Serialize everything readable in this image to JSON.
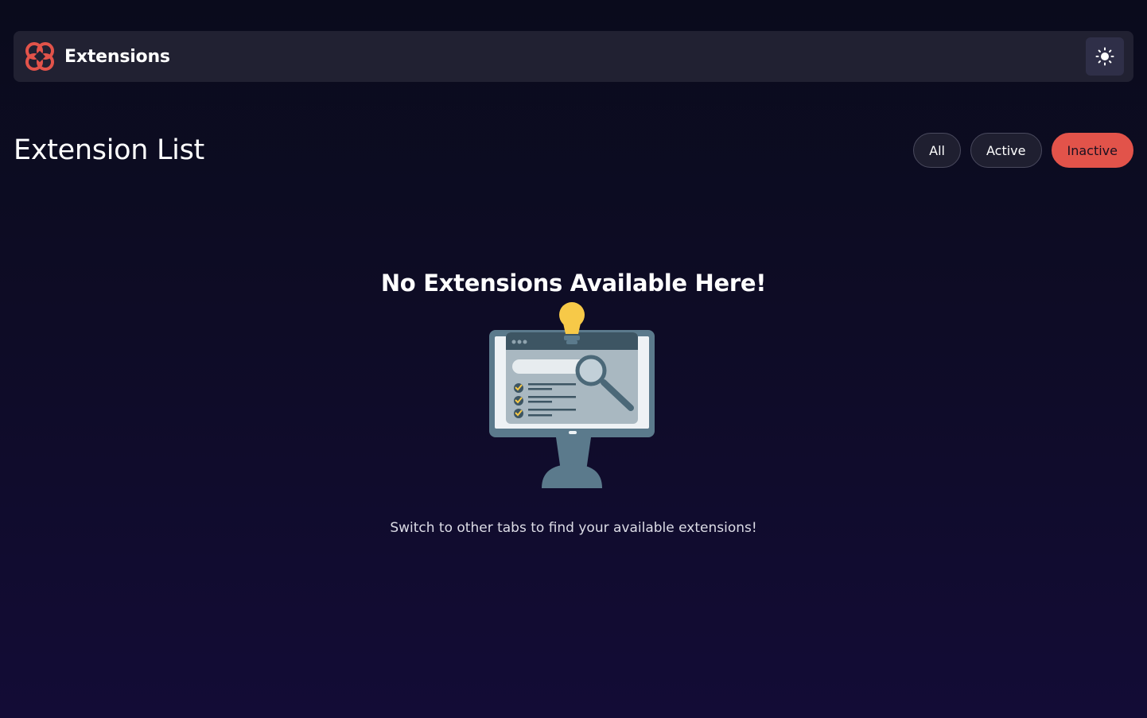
{
  "header": {
    "brand_name": "Extensions",
    "logo_icon": "clover-logo-icon",
    "theme_toggle_icon": "sun-icon"
  },
  "list": {
    "title": "Extension List",
    "filters": [
      {
        "label": "All",
        "selected": false
      },
      {
        "label": "Active",
        "selected": false
      },
      {
        "label": "Inactive",
        "selected": true
      }
    ]
  },
  "empty_state": {
    "title": "No Extensions Available Here!",
    "illustration_icon": "monitor-search-illustration",
    "message": "Switch to other tabs to find your available extensions!"
  },
  "colors": {
    "accent": "#e2534a",
    "header_bg": "#212132",
    "background_top": "#0a0b1c",
    "background_bottom": "#130c36",
    "bulb": "#f7c948",
    "monitor": "#5b7a8c"
  }
}
